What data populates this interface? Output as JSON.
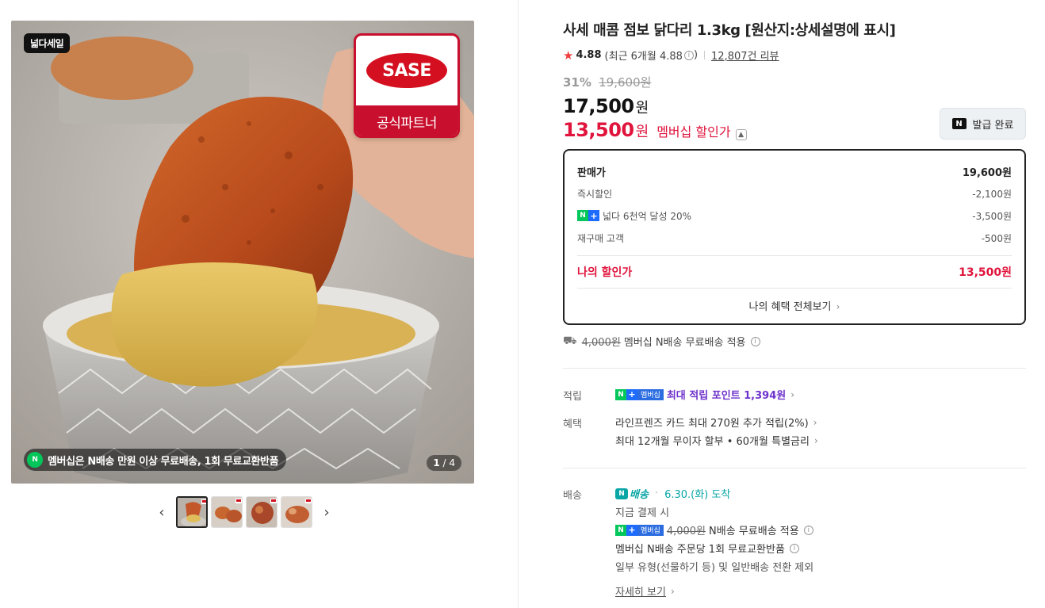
{
  "gallery": {
    "badge": "넓다세일",
    "brand_logo": "SASE",
    "brand_partner": "공식파트너",
    "caption_icon": "N",
    "caption": "멤버십은 N배송 만원 이상 무료배송, 1회 무료교환반품",
    "counter_current": "1",
    "counter_total": "/ 4",
    "prev_label": "‹",
    "next_label": "›",
    "thumb_count": 4
  },
  "product": {
    "title": "사세 매콤 점보 닭다리 1.3kg [원산지:상세설명에 표시]",
    "rating": "4.88",
    "recent_rating": "(최근 6개월 4.88",
    "recent_rating_close": ")",
    "review_count": "12,807건 리뷰",
    "discount_rate": "31%",
    "original_price": "19,600원",
    "sale_price": "17,500",
    "won": "원",
    "member_price": "13,500",
    "member_label": "멤버십 할인가",
    "coupon_button": "발급 완료"
  },
  "price_box": {
    "rows": [
      {
        "label": "판매가",
        "value": "19,600원"
      },
      {
        "label": "즉시할인",
        "value": "-2,100원"
      },
      {
        "label": "넓다 6천억 달성 20%",
        "value": "-3,500원"
      },
      {
        "label": "재구매 고객",
        "value": "-500원"
      }
    ],
    "mine_label": "나의 할인가",
    "mine_value": "13,500원",
    "more_label": "나의 혜택 전체보기"
  },
  "shipping_summary": {
    "strike": "4,000원",
    "text": "멤버십 N배송 무료배송 적용"
  },
  "points": {
    "label": "적립",
    "badge_m": "멤버십",
    "text": "최대 적립 포인트 1,394원"
  },
  "benefits": {
    "label": "혜택",
    "lines": [
      "라인프렌즈 카드 최대 270원 추가 적립(2%)",
      "최대 12개월 무이자 할부 • 60개월 특별금리"
    ]
  },
  "delivery": {
    "label": "배송",
    "nbaesong": "배송",
    "arrival": "6.30.(화) 도착",
    "pay_now": "지금 결제 시",
    "strike": "4,000원",
    "free_text": "N배송 무료배송 적용",
    "exchange": "멤버십 N배송 주문당 1회 무료교환반품",
    "exclude": "일부 유형(선물하기 등) 및 일반배송 전환 제외",
    "detail_link": "자세히 보기"
  },
  "colors": {
    "accent_red": "#e0143c",
    "naver_green": "#03c75a",
    "purple": "#6e33cb",
    "teal": "#09a6a6"
  }
}
